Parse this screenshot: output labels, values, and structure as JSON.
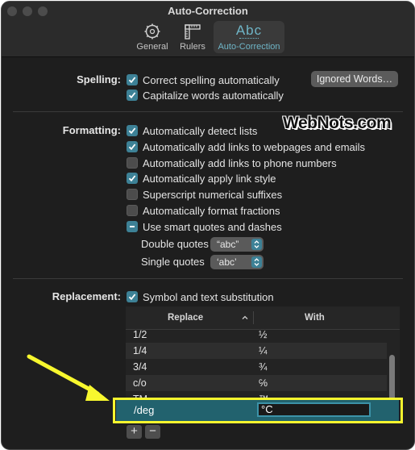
{
  "window": {
    "title": "Auto-Correction"
  },
  "toolbar": {
    "tabs": [
      {
        "label": "General",
        "icon": "gear-icon"
      },
      {
        "label": "Rulers",
        "icon": "ruler-icon"
      },
      {
        "label": "Auto-Correction",
        "icon": "abc-icon",
        "glyph": "Abc",
        "active": true
      }
    ]
  },
  "spelling": {
    "label": "Spelling:",
    "items": [
      {
        "label": "Correct spelling automatically",
        "state": "checked"
      },
      {
        "label": "Capitalize words automatically",
        "state": "checked"
      }
    ],
    "button": "Ignored Words…"
  },
  "formatting": {
    "label": "Formatting:",
    "items": [
      {
        "label": "Automatically detect lists",
        "state": "checked"
      },
      {
        "label": "Automatically add links to webpages and emails",
        "state": "checked"
      },
      {
        "label": "Automatically add links to phone numbers",
        "state": "unchecked"
      },
      {
        "label": "Automatically apply link style",
        "state": "checked"
      },
      {
        "label": "Superscript numerical suffixes",
        "state": "unchecked"
      },
      {
        "label": "Automatically format fractions",
        "state": "unchecked"
      },
      {
        "label": "Use smart quotes and dashes",
        "state": "mixed"
      }
    ],
    "double_quotes": {
      "label": "Double quotes",
      "value": "“abc”"
    },
    "single_quotes": {
      "label": "Single quotes",
      "value": "‘abc’"
    }
  },
  "replacement": {
    "label": "Replacement:",
    "checkbox": {
      "label": "Symbol and text substitution",
      "state": "checked"
    },
    "columns": {
      "replace": "Replace",
      "with": "With"
    },
    "rows": [
      {
        "replace": "1/2",
        "with": "½"
      },
      {
        "replace": "1/4",
        "with": "¼"
      },
      {
        "replace": "3/4",
        "with": "¾"
      },
      {
        "replace": "c/o",
        "with": "℅"
      },
      {
        "replace": "TM",
        "with": "™"
      }
    ],
    "selected_row": {
      "replace": "/deg",
      "with": "°C"
    },
    "add_label": "+",
    "remove_label": "−"
  },
  "watermark": "WebNots.com",
  "colors": {
    "accent": "#3d8196",
    "highlight": "#f7f72e",
    "selection": "#22626e"
  }
}
